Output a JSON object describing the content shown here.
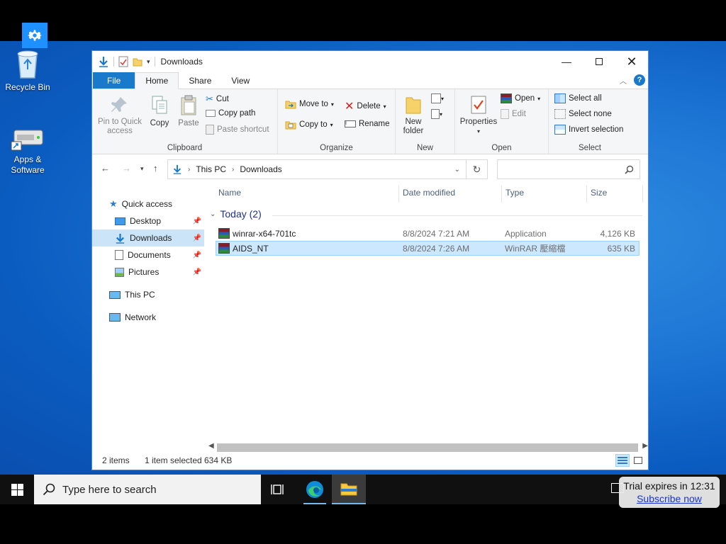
{
  "desktop": {
    "icons": [
      {
        "label": "Recycle Bin",
        "icon": "recycle-bin-icon"
      },
      {
        "label": "Apps & Software",
        "icon": "apps-software-icon"
      }
    ]
  },
  "window": {
    "title": "Downloads",
    "tabs": {
      "file": "File",
      "home": "Home",
      "share": "Share",
      "view": "View"
    },
    "ribbon": {
      "clipboard": {
        "name": "Clipboard",
        "pin_label_1": "Pin to Quick",
        "pin_label_2": "access",
        "copy": "Copy",
        "paste": "Paste",
        "cut": "Cut",
        "copy_path": "Copy path",
        "paste_shortcut": "Paste shortcut"
      },
      "organize": {
        "name": "Organize",
        "move_to": "Move to",
        "copy_to": "Copy to",
        "delete": "Delete",
        "rename": "Rename"
      },
      "new": {
        "name": "New",
        "new_folder_1": "New",
        "new_folder_2": "folder"
      },
      "open": {
        "name": "Open",
        "properties": "Properties",
        "open": "Open",
        "edit": "Edit"
      },
      "select": {
        "name": "Select",
        "select_all": "Select all",
        "select_none": "Select none",
        "invert": "Invert selection"
      }
    },
    "address": {
      "crumbs": [
        "This PC",
        "Downloads"
      ],
      "search_placeholder": ""
    },
    "nav": {
      "quick_access": "Quick access",
      "items": [
        {
          "label": "Desktop",
          "pinned": true
        },
        {
          "label": "Downloads",
          "pinned": true,
          "selected": true
        },
        {
          "label": "Documents",
          "pinned": true
        },
        {
          "label": "Pictures",
          "pinned": true
        }
      ],
      "this_pc": "This PC",
      "network": "Network"
    },
    "columns": {
      "name": "Name",
      "date": "Date modified",
      "type": "Type",
      "size": "Size"
    },
    "group_label": "Today (2)",
    "files": [
      {
        "name": "winrar-x64-701tc",
        "date": "8/8/2024 7:21 AM",
        "type": "Application",
        "size": "4,126 KB",
        "selected": false
      },
      {
        "name": "AIDS_NT",
        "date": "8/8/2024 7:26 AM",
        "type": "WinRAR 壓縮檔",
        "size": "635 KB",
        "selected": true
      }
    ],
    "status": {
      "items": "2 items",
      "selection": "1 item selected",
      "size": "634 KB"
    }
  },
  "taskbar": {
    "search_placeholder": "Type here to search"
  },
  "trial": {
    "text": "Trial expires in 12:31",
    "link": "Subscribe now"
  },
  "colors": {
    "accent": "#1979ca",
    "selection": "#cce8ff",
    "desktop": "#1f78d6"
  }
}
